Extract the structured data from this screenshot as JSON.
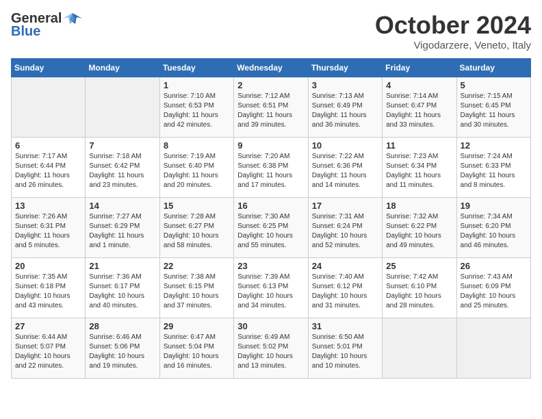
{
  "header": {
    "logo_general": "General",
    "logo_blue": "Blue",
    "month_title": "October 2024",
    "location": "Vigodarzere, Veneto, Italy"
  },
  "days_of_week": [
    "Sunday",
    "Monday",
    "Tuesday",
    "Wednesday",
    "Thursday",
    "Friday",
    "Saturday"
  ],
  "weeks": [
    [
      {
        "day": "",
        "details": ""
      },
      {
        "day": "",
        "details": ""
      },
      {
        "day": "1",
        "details": "Sunrise: 7:10 AM\nSunset: 6:53 PM\nDaylight: 11 hours and 42 minutes."
      },
      {
        "day": "2",
        "details": "Sunrise: 7:12 AM\nSunset: 6:51 PM\nDaylight: 11 hours and 39 minutes."
      },
      {
        "day": "3",
        "details": "Sunrise: 7:13 AM\nSunset: 6:49 PM\nDaylight: 11 hours and 36 minutes."
      },
      {
        "day": "4",
        "details": "Sunrise: 7:14 AM\nSunset: 6:47 PM\nDaylight: 11 hours and 33 minutes."
      },
      {
        "day": "5",
        "details": "Sunrise: 7:15 AM\nSunset: 6:45 PM\nDaylight: 11 hours and 30 minutes."
      }
    ],
    [
      {
        "day": "6",
        "details": "Sunrise: 7:17 AM\nSunset: 6:44 PM\nDaylight: 11 hours and 26 minutes."
      },
      {
        "day": "7",
        "details": "Sunrise: 7:18 AM\nSunset: 6:42 PM\nDaylight: 11 hours and 23 minutes."
      },
      {
        "day": "8",
        "details": "Sunrise: 7:19 AM\nSunset: 6:40 PM\nDaylight: 11 hours and 20 minutes."
      },
      {
        "day": "9",
        "details": "Sunrise: 7:20 AM\nSunset: 6:38 PM\nDaylight: 11 hours and 17 minutes."
      },
      {
        "day": "10",
        "details": "Sunrise: 7:22 AM\nSunset: 6:36 PM\nDaylight: 11 hours and 14 minutes."
      },
      {
        "day": "11",
        "details": "Sunrise: 7:23 AM\nSunset: 6:34 PM\nDaylight: 11 hours and 11 minutes."
      },
      {
        "day": "12",
        "details": "Sunrise: 7:24 AM\nSunset: 6:33 PM\nDaylight: 11 hours and 8 minutes."
      }
    ],
    [
      {
        "day": "13",
        "details": "Sunrise: 7:26 AM\nSunset: 6:31 PM\nDaylight: 11 hours and 5 minutes."
      },
      {
        "day": "14",
        "details": "Sunrise: 7:27 AM\nSunset: 6:29 PM\nDaylight: 11 hours and 1 minute."
      },
      {
        "day": "15",
        "details": "Sunrise: 7:28 AM\nSunset: 6:27 PM\nDaylight: 10 hours and 58 minutes."
      },
      {
        "day": "16",
        "details": "Sunrise: 7:30 AM\nSunset: 6:25 PM\nDaylight: 10 hours and 55 minutes."
      },
      {
        "day": "17",
        "details": "Sunrise: 7:31 AM\nSunset: 6:24 PM\nDaylight: 10 hours and 52 minutes."
      },
      {
        "day": "18",
        "details": "Sunrise: 7:32 AM\nSunset: 6:22 PM\nDaylight: 10 hours and 49 minutes."
      },
      {
        "day": "19",
        "details": "Sunrise: 7:34 AM\nSunset: 6:20 PM\nDaylight: 10 hours and 46 minutes."
      }
    ],
    [
      {
        "day": "20",
        "details": "Sunrise: 7:35 AM\nSunset: 6:18 PM\nDaylight: 10 hours and 43 minutes."
      },
      {
        "day": "21",
        "details": "Sunrise: 7:36 AM\nSunset: 6:17 PM\nDaylight: 10 hours and 40 minutes."
      },
      {
        "day": "22",
        "details": "Sunrise: 7:38 AM\nSunset: 6:15 PM\nDaylight: 10 hours and 37 minutes."
      },
      {
        "day": "23",
        "details": "Sunrise: 7:39 AM\nSunset: 6:13 PM\nDaylight: 10 hours and 34 minutes."
      },
      {
        "day": "24",
        "details": "Sunrise: 7:40 AM\nSunset: 6:12 PM\nDaylight: 10 hours and 31 minutes."
      },
      {
        "day": "25",
        "details": "Sunrise: 7:42 AM\nSunset: 6:10 PM\nDaylight: 10 hours and 28 minutes."
      },
      {
        "day": "26",
        "details": "Sunrise: 7:43 AM\nSunset: 6:09 PM\nDaylight: 10 hours and 25 minutes."
      }
    ],
    [
      {
        "day": "27",
        "details": "Sunrise: 6:44 AM\nSunset: 5:07 PM\nDaylight: 10 hours and 22 minutes."
      },
      {
        "day": "28",
        "details": "Sunrise: 6:46 AM\nSunset: 5:06 PM\nDaylight: 10 hours and 19 minutes."
      },
      {
        "day": "29",
        "details": "Sunrise: 6:47 AM\nSunset: 5:04 PM\nDaylight: 10 hours and 16 minutes."
      },
      {
        "day": "30",
        "details": "Sunrise: 6:49 AM\nSunset: 5:02 PM\nDaylight: 10 hours and 13 minutes."
      },
      {
        "day": "31",
        "details": "Sunrise: 6:50 AM\nSunset: 5:01 PM\nDaylight: 10 hours and 10 minutes."
      },
      {
        "day": "",
        "details": ""
      },
      {
        "day": "",
        "details": ""
      }
    ]
  ]
}
